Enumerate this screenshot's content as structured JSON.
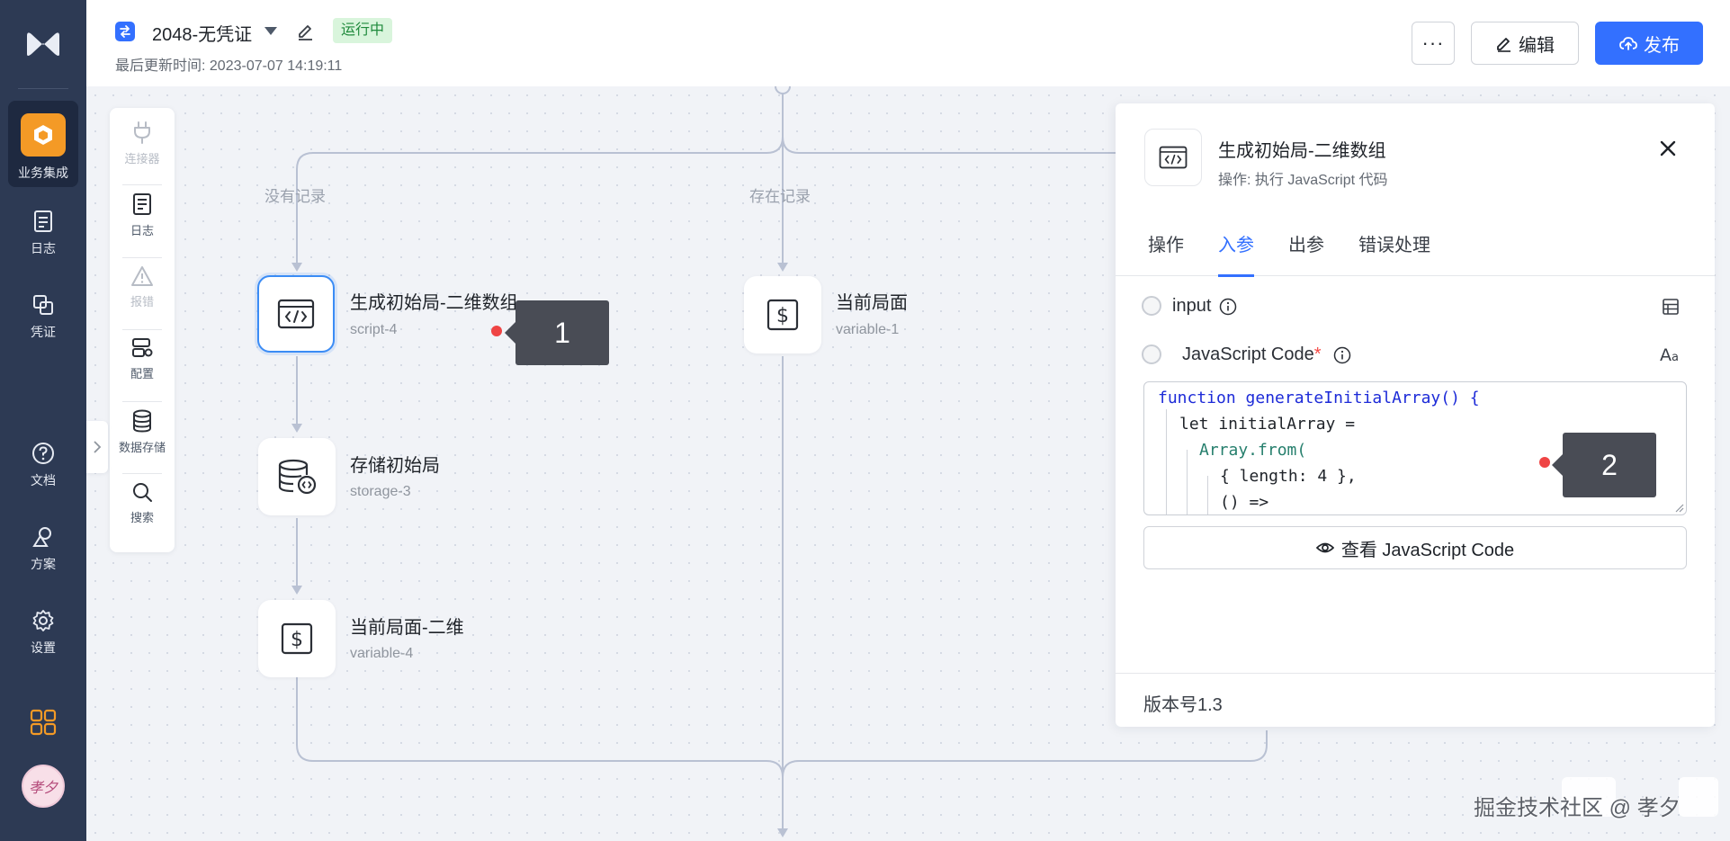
{
  "nav": {
    "items": [
      {
        "label": "业务集成",
        "icon": "integration-icon",
        "active": true
      },
      {
        "label": "日志",
        "icon": "log-icon"
      },
      {
        "label": "凭证",
        "icon": "credential-icon"
      },
      {
        "label": "文档",
        "icon": "help-icon"
      },
      {
        "label": "方案",
        "icon": "solution-icon"
      },
      {
        "label": "设置",
        "icon": "settings-icon"
      }
    ],
    "avatar_text": "孝夕"
  },
  "header": {
    "flow_name": "2048-无凭证",
    "status": "运行中",
    "updated_label": "最后更新时间:",
    "updated_time": "2023-07-07 14:19:11",
    "more_label": "···",
    "edit_label": "编辑",
    "publish_label": "发布"
  },
  "toolbox": [
    {
      "label": "连接器",
      "icon": "plug-icon",
      "enabled": false
    },
    {
      "label": "日志",
      "icon": "log-icon",
      "enabled": true
    },
    {
      "label": "报错",
      "icon": "warning-icon",
      "enabled": false
    },
    {
      "label": "配置",
      "icon": "config-icon",
      "enabled": true
    },
    {
      "label": "数据存储",
      "icon": "database-icon",
      "enabled": true
    },
    {
      "label": "搜索",
      "icon": "search-icon",
      "enabled": true
    }
  ],
  "canvas": {
    "branch_labels": [
      "没有记录",
      "存在记录"
    ],
    "nodes": [
      {
        "title": "生成初始局-二维数组",
        "id": "script-4",
        "icon": "code-icon",
        "selected": true
      },
      {
        "title": "存储初始局",
        "id": "storage-3",
        "icon": "storage-icon"
      },
      {
        "title": "当前局面-二维",
        "id": "variable-4",
        "icon": "variable-icon"
      },
      {
        "title": "当前局面",
        "id": "variable-1",
        "icon": "variable-icon"
      }
    ],
    "callouts": [
      "1",
      "2"
    ]
  },
  "panel": {
    "title": "生成初始局-二维数组",
    "subtitle": "操作: 执行 JavaScript 代码",
    "tabs": [
      "操作",
      "入参",
      "出参",
      "错误处理"
    ],
    "active_tab": "入参",
    "field_input_label": "input",
    "field_code_label": "JavaScript Code",
    "required_mark": "*",
    "code_lines": [
      "function generateInitialArray() {",
      "let initialArray =",
      "Array.from(",
      "{ length: 4 },",
      "() =>"
    ],
    "view_button_label": "查看 JavaScript Code",
    "version": "版本号1.3"
  },
  "watermark": "掘金技术社区 @ 孝夕",
  "colors": {
    "nav_bg": "#2d3a54",
    "accent": "#3370ff",
    "active_orange": "#f49a26",
    "status_green_bg": "#d9f5dc",
    "selected_border": "#3b8cf5",
    "callout": "#494c55",
    "dot_red": "#ef4444"
  }
}
